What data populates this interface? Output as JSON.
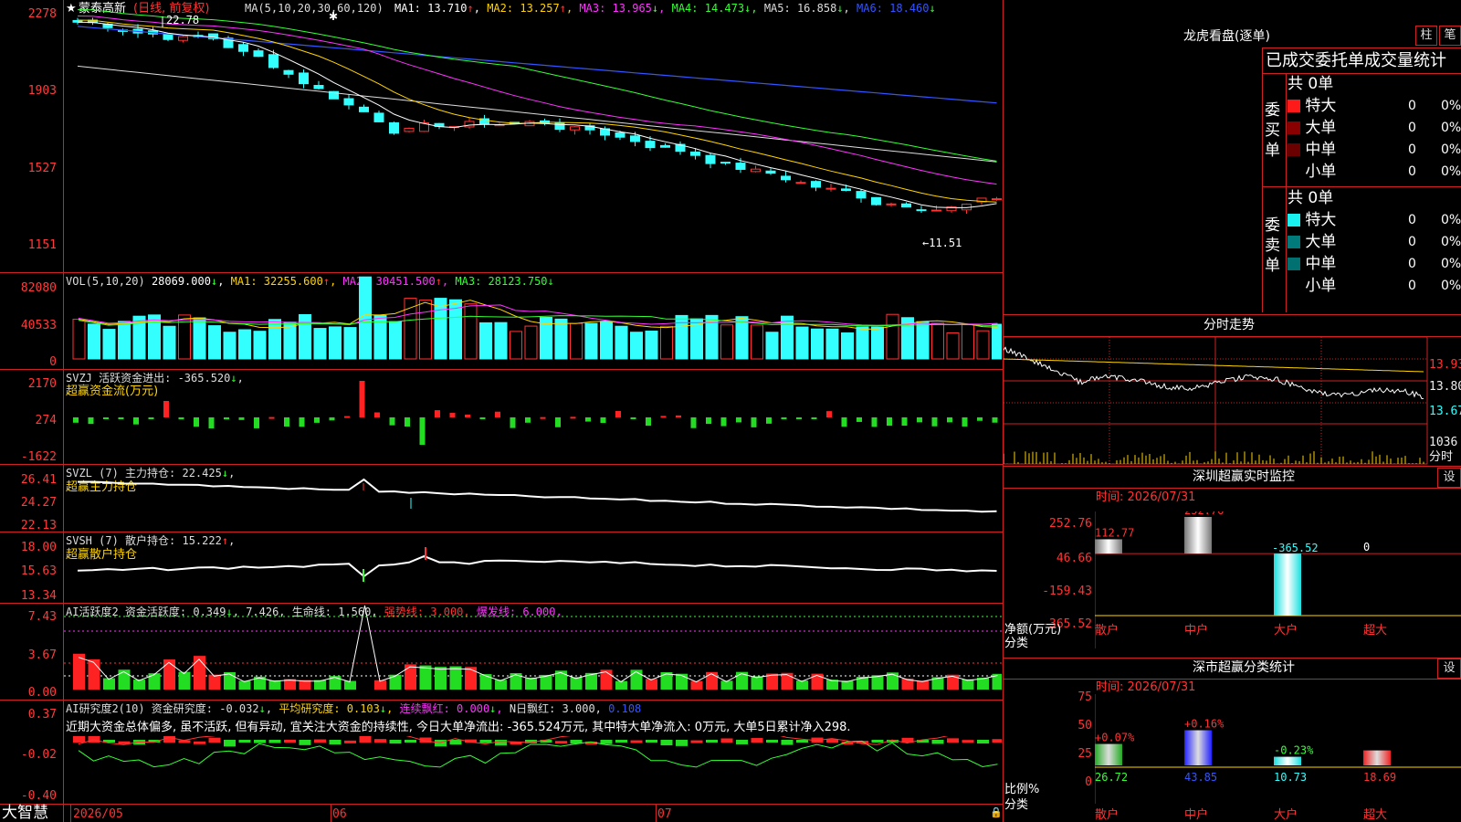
{
  "main": {
    "stock_name": "蒙泰高新",
    "mode": "(日线, 前复权)",
    "ma_label": "MA(5,10,20,30,60,120)",
    "ma": [
      {
        "label": "MA1:",
        "value": "13.710",
        "color": "#ffffff"
      },
      {
        "label": "MA2:",
        "value": "13.257",
        "color": "#ffd400"
      },
      {
        "label": "MA3:",
        "value": "13.965",
        "color": "#ff33ff"
      },
      {
        "label": "MA4:",
        "value": "14.473",
        "color": "#33ff33"
      },
      {
        "label": "MA5:",
        "value": "16.858",
        "color": "#dddddd"
      },
      {
        "label": "MA6:",
        "value": "18.460",
        "color": "#3355ff"
      }
    ],
    "high_mark": "22.78",
    "low_mark": "11.51",
    "y_ticks": [
      "2278",
      "1903",
      "1527",
      "1151"
    ]
  },
  "vol": {
    "label": "VOL(5,10,20)",
    "value": "28069.000",
    "ma1": "MA1: 32255.600",
    "ma2": "MA2: 30451.500",
    "ma3": "MA3: 28123.750",
    "y_ticks": [
      "82080",
      "40533",
      "0"
    ]
  },
  "svzj": {
    "label": "SVZJ  活跃资金进出: -365.520",
    "sub": "超赢资金流(万元)",
    "y_ticks": [
      "2170",
      "274",
      "-1622"
    ]
  },
  "svzl": {
    "label": "SVZL  (7) 主力持仓: 22.425",
    "sub": "超赢主力持仓",
    "y_ticks": [
      "26.41",
      "24.27",
      "22.13"
    ]
  },
  "svsh": {
    "label": "SVSH  (7) 散户持仓: 15.222",
    "sub": "超赢散户持仓",
    "y_ticks": [
      "18.00",
      "15.63",
      "13.34"
    ]
  },
  "ai_act": {
    "label": "AI活跃度2 资金活跃度: 0.349",
    "v2": "7.426,",
    "life": "生命线: 1.560,",
    "strong": "强势线: 3.000,",
    "burst": "爆发线: 6.000,",
    "y_ticks": [
      "7.43",
      "3.67",
      "0.00"
    ]
  },
  "ai_res": {
    "label": "AI研究度2(10) 资金研究度: -0.032",
    "avg": "平均研究度: 0.103",
    "cont": "连续飘红: 0.000",
    "nday": "N日飘红: 3.000,",
    "tail": "0.108",
    "comment": "近期大资金总体偏多, 虽不活跃, 但有异动, 宜关注大资金的持续性, 今日大单净流出: -365.524万元, 其中特大单净流入: 0万元, 大单5日累计净入298.",
    "y_ticks": [
      "0.37",
      "-0.02",
      "-0.40"
    ]
  },
  "bottom": {
    "brand": "大智慧",
    "dates": [
      "2026/05",
      "06",
      "07"
    ]
  },
  "right": {
    "title": "龙虎看盘(逐单)",
    "btn_zhu": "柱",
    "btn_bi": "笔",
    "stats_title": "已成交委托单成交量统计",
    "buy_label": "委买单",
    "sell_label": "委卖单",
    "buy_total": "共 0单",
    "sell_total": "共 0单",
    "buy_rows": [
      {
        "name": "特大",
        "count": "0",
        "pct": "0%",
        "color": "#ff1a1a"
      },
      {
        "name": "大单",
        "count": "0",
        "pct": "0%",
        "color": "#8a0000"
      },
      {
        "name": "中单",
        "count": "0",
        "pct": "0%",
        "color": "#6a0000"
      },
      {
        "name": "小单",
        "count": "0",
        "pct": "0%",
        "color": ""
      }
    ],
    "sell_rows": [
      {
        "name": "特大",
        "count": "0",
        "pct": "0%",
        "color": "#19f0f0"
      },
      {
        "name": "大单",
        "count": "0",
        "pct": "0%",
        "color": "#007a7a"
      },
      {
        "name": "中单",
        "count": "0",
        "pct": "0%",
        "color": "#007070"
      },
      {
        "name": "小单",
        "count": "0",
        "pct": "0%",
        "color": ""
      }
    ],
    "intraday_title": "分时走势",
    "intraday_prices": [
      "13.93",
      "13.80",
      "13.67"
    ],
    "intraday_vol": "1036",
    "intraday_vol_label": "分时",
    "sz_title": "深圳超赢实时监控",
    "sz_btn": "设",
    "sz_time": "时间: 2026/07/31",
    "sz_y": [
      "252.76",
      "46.66",
      "-159.43",
      "-365.52"
    ],
    "sz_y_label": "净额(万元)",
    "sz_cat_label": "分类",
    "sz_bars": [
      {
        "cat": "散户",
        "value": 112.77,
        "label": "112.77"
      },
      {
        "cat": "中户",
        "value": 252.76,
        "label": "252.76"
      },
      {
        "cat": "大户",
        "value": -365.52,
        "label": "-365.52"
      },
      {
        "cat": "超大",
        "value": 0,
        "label": "0"
      }
    ],
    "cls_title": "深市超赢分类统计",
    "cls_btn": "设",
    "cls_time": "时间: 2026/07/31",
    "cls_y": [
      "75",
      "50",
      "25",
      "0"
    ],
    "cls_y_label": "比例%",
    "cls_cat_label": "分类",
    "cls_bars": [
      {
        "cat": "散户",
        "value": 26.72,
        "label": "26.72",
        "delta": "+0.07%"
      },
      {
        "cat": "中户",
        "value": 43.85,
        "label": "43.85",
        "delta": "+0.16%"
      },
      {
        "cat": "大户",
        "value": 10.73,
        "label": "10.73",
        "delta": "-0.23%"
      },
      {
        "cat": "超大",
        "value": 18.69,
        "label": "18.69",
        "delta": ""
      }
    ]
  },
  "chart_data": {
    "type": "candlestick",
    "series": [
      {
        "name": "MA1",
        "values": []
      },
      {
        "name": "MA2",
        "values": []
      }
    ]
  }
}
